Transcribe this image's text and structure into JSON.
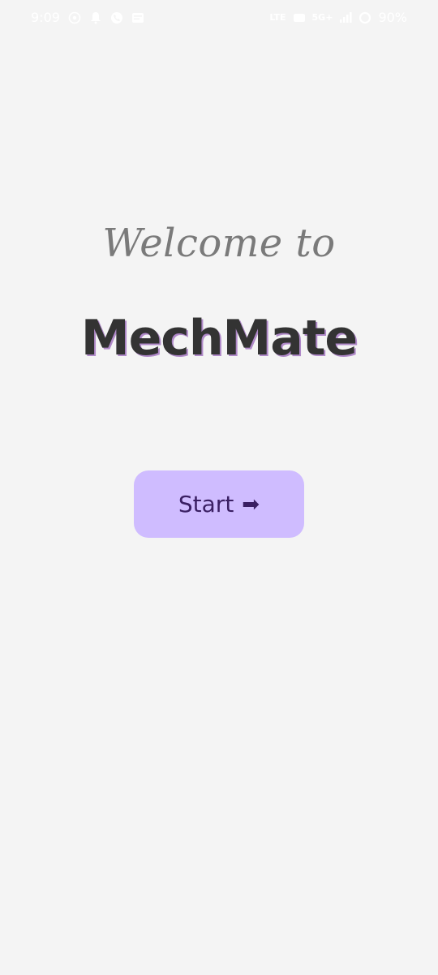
{
  "status_bar": {
    "time": "9:09",
    "network_label": "5G+",
    "lte_label": "LTE",
    "battery_percent": "90%"
  },
  "welcome": {
    "greeting": "Welcome to",
    "app_name": "MechMate"
  },
  "start": {
    "label": "Start",
    "arrow": "➡"
  },
  "colors": {
    "background": "#f4f4f4",
    "button_bg": "#cfbcff",
    "button_text": "#3a1f63",
    "title_text": "#333333",
    "title_shadow": "#b089c9",
    "greeting_text": "#7a7a7a"
  },
  "icons": [
    "whatsapp-icon",
    "notification-bell-icon",
    "call-icon",
    "message-icon",
    "lte-icon",
    "data-icon",
    "signal-icon",
    "battery-ring-icon"
  ]
}
